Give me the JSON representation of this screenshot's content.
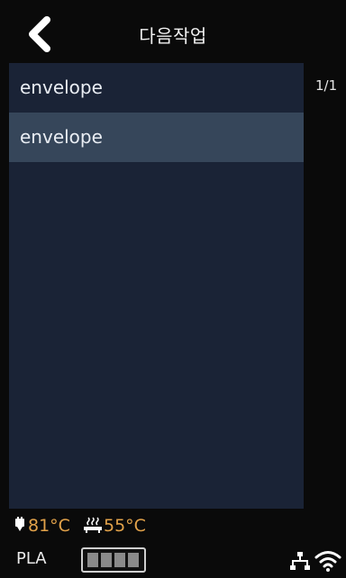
{
  "header": {
    "title": "다음작업",
    "back_icon": "chevron-left-icon"
  },
  "list": {
    "items": [
      {
        "label": "envelope",
        "selected": false
      },
      {
        "label": "envelope",
        "selected": true
      }
    ],
    "page_indicator": "1/1"
  },
  "status": {
    "nozzle_icon": "nozzle-icon",
    "nozzle_temp": "81°C",
    "bed_icon": "heated-bed-icon",
    "bed_temp": "55°C"
  },
  "footer": {
    "material": "PLA",
    "filament_icon": "filament-level-icon",
    "network_icon": "ethernet-icon",
    "wifi_icon": "wifi-icon"
  },
  "colors": {
    "panel": "#1a2336",
    "selected_row": "#36465a",
    "temperature": "#e2a24a"
  }
}
